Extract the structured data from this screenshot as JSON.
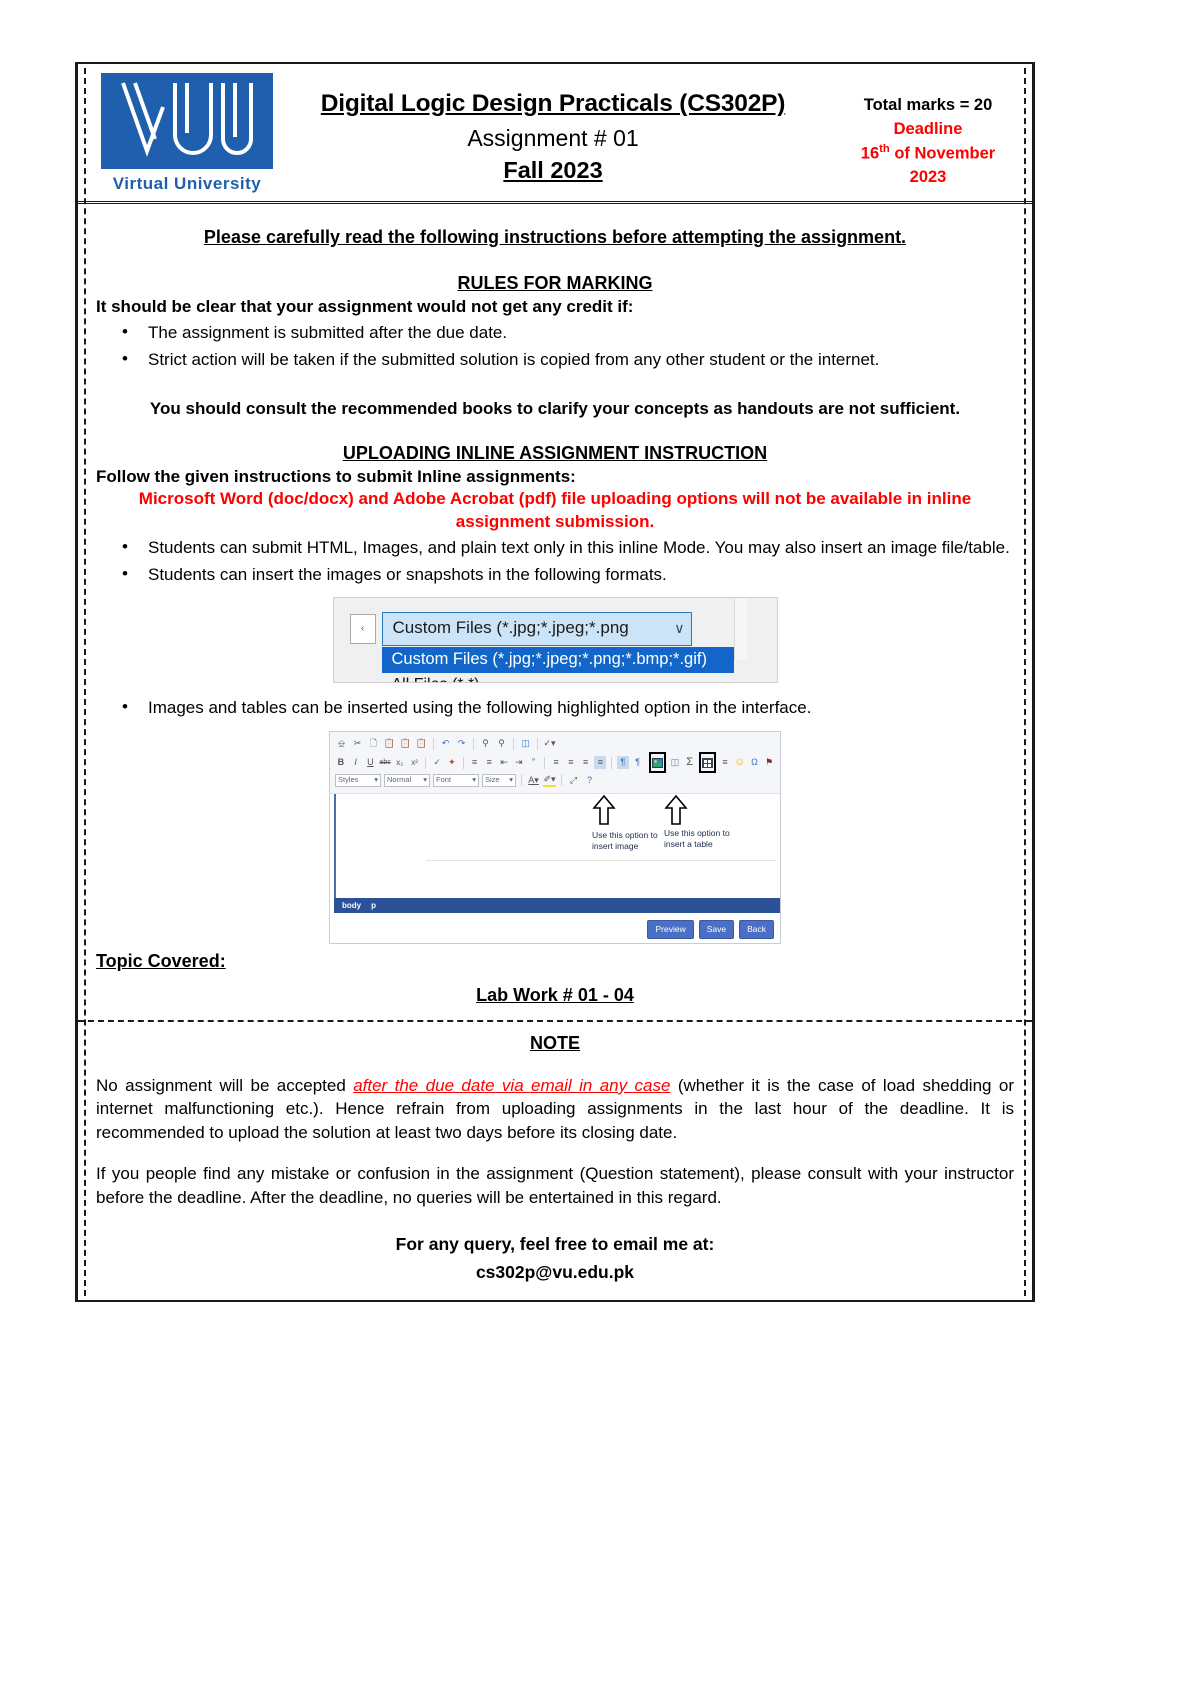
{
  "header": {
    "logo_alt": "VU",
    "logo_subtitle": "Virtual University",
    "course_title": "Digital Logic Design Practicals (CS302P)",
    "assignment_line": "Assignment # 01",
    "term": "Fall 2023",
    "total_marks": "Total marks = 20",
    "deadline_label": "Deadline",
    "deadline_day": "16",
    "deadline_day_suffix": "th",
    "deadline_month": " of November",
    "deadline_year": "2023"
  },
  "body": {
    "lead": "Please carefully read the following instructions before attempting the assignment.",
    "rules_heading": "RULES FOR MARKING",
    "rules_intro": "It should be clear that your assignment would not get any credit if:",
    "rules_bullets": [
      "The assignment is submitted after the due date.",
      "Strict action will be taken if the submitted solution is copied from any other student or the internet."
    ],
    "consult_note": "You should consult the recommended books to clarify your concepts as handouts are not sufficient.",
    "uploading_heading": "UPLOADING INLINE ASSIGNMENT INSTRUCTION",
    "uploading_intro": "Follow the given instructions to submit Inline assignments:",
    "red_note": "Microsoft Word (doc/docx) and Adobe Acrobat (pdf) file uploading options will not be available in inline assignment submission.",
    "upload_bullets": [
      "Students can submit HTML, Images, and plain text only in this inline Mode. You may also insert an image file/table.",
      "Students can insert the images or snapshots in the following formats.",
      "Images and tables can be inserted using the following highlighted option in the interface."
    ],
    "topic_label": "Topic Covered:",
    "topic_value": "Lab Work # 01 - 04",
    "note_heading": "NOTE",
    "note_p1_a": "No assignment will be accepted ",
    "note_p1_em": "after the due date via email in any case",
    "note_p1_b": " (whether it is the case of load shedding or internet malfunctioning etc.). Hence refrain from uploading assignments in the last hour of the deadline. It is recommended to upload the solution at least two days before its closing date.",
    "note_p2": "If you people find any mistake or confusion in the assignment (Question statement), please consult with your instructor before the deadline. After the deadline, no queries will be entertained in this regard.",
    "query_line": "For any query, feel free to email me at:",
    "query_email": "cs302p@vu.edu.pk"
  },
  "file_dialog_shot": {
    "left_stub": "‹",
    "combo_value": "Custom Files (*.jpg;*.jpeg;*.png",
    "combo_caret": "∨",
    "option_highlighted": "Custom Files (*.jpg;*.jpeg;*.png;*.bmp;*.gif)",
    "option_second": "All Files (*.*)"
  },
  "editor_shot": {
    "row1_icons": [
      "source-icon",
      "cut-icon",
      "copy-icon",
      "paste-icon",
      "paste-text-icon",
      "paste-word-icon",
      "undo-icon",
      "redo-icon",
      "find-icon",
      "replace-icon",
      "select-all-icon",
      "spellcheck-icon"
    ],
    "row1_glyphs": [
      "❐",
      "✂",
      "❐",
      "Ὄb",
      "❐",
      "❐",
      "↶",
      "↷",
      "⌕",
      "⌕",
      "❐",
      "✓"
    ],
    "row2_glyphs": [
      "B",
      "I",
      "U",
      "abc",
      "x₂",
      "x²",
      "✎",
      "✐",
      "≡",
      "≡",
      "⇤",
      "⇥",
      "”",
      "≡",
      "≡",
      "≡",
      "≡",
      "¶",
      "¶"
    ],
    "dropdowns": [
      "Styles",
      "Normal",
      "Font",
      "Size"
    ],
    "row3_glyphs": [
      "A▾",
      "✎▾",
      "⤢",
      "?"
    ],
    "insert_image_icon": "insert-image-icon",
    "insert_table_icon": "insert-table-icon",
    "annotation_image": "Use this option to insert image",
    "annotation_table": "Use this option to insert a table",
    "status_body": "body",
    "status_p": "p",
    "buttons": [
      "Preview",
      "Save",
      "Back"
    ]
  }
}
